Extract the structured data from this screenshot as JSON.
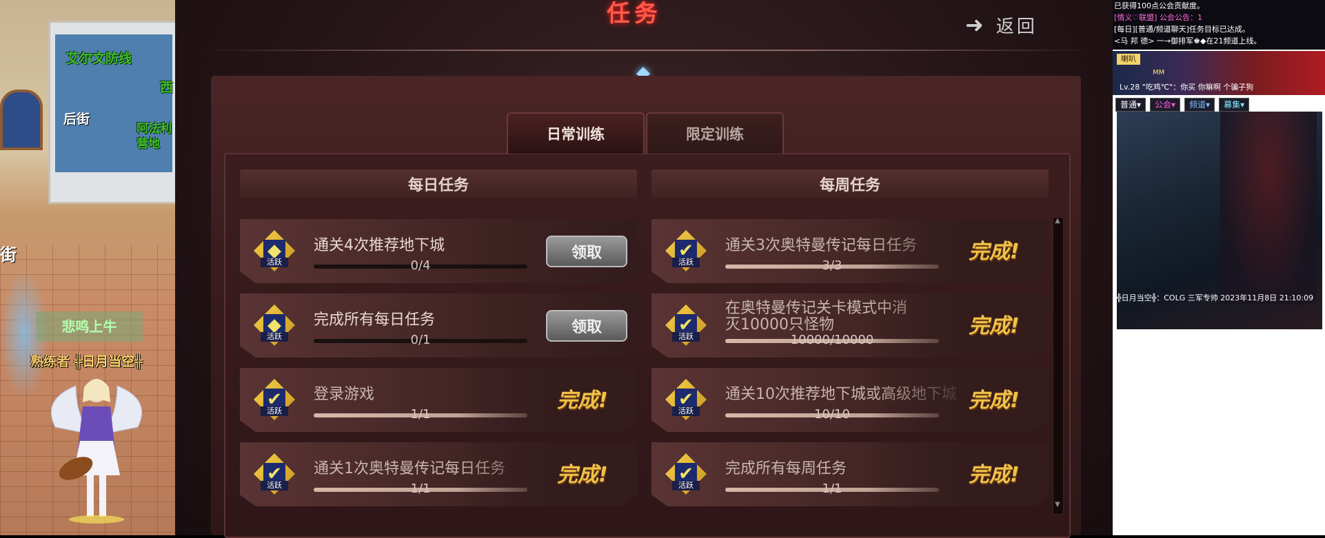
{
  "scene": {
    "map_labels": [
      "艾尔文防线",
      "后街",
      "阿法利营地",
      "西",
      "街"
    ],
    "sign_text": "悲鸣上牛",
    "character": {
      "prefix": "熟练者",
      "name": "╬日月当空╬"
    }
  },
  "header": {
    "title": "任务",
    "back_label": "返回",
    "back_icon": "arrow-left-icon"
  },
  "tabs": [
    {
      "label": "日常训练",
      "active": true
    },
    {
      "label": "限定训练",
      "active": false
    }
  ],
  "daily": {
    "header": "每日任务",
    "items": [
      {
        "name": "通关4次推荐地下城",
        "progress": "0/4",
        "fraction": 0.0,
        "status": "claim",
        "button": "领取",
        "icon": "dungeon-ticket-icon"
      },
      {
        "name": "完成所有每日任务",
        "progress": "0/1",
        "fraction": 0.0,
        "status": "claim",
        "button": "领取",
        "icon": "gem-box-icon"
      },
      {
        "name": "登录游戏",
        "progress": "1/1",
        "fraction": 1.0,
        "status": "done",
        "done_label": "完成!",
        "icon": "check-icon"
      },
      {
        "name": "通关1次奥特曼传记每日任务",
        "progress": "1/1",
        "fraction": 1.0,
        "status": "done",
        "done_label": "完成!",
        "icon": "check-icon"
      }
    ]
  },
  "weekly": {
    "header": "每周任务",
    "items": [
      {
        "name": "通关3次奥特曼传记每日任务",
        "progress": "3/3",
        "fraction": 1.0,
        "status": "done",
        "done_label": "完成!",
        "icon": "check-icon"
      },
      {
        "name": "在奥特曼传记关卡模式中消灭10000只怪物",
        "progress": "10000/10000",
        "fraction": 1.0,
        "status": "done",
        "done_label": "完成!",
        "icon": "check-icon"
      },
      {
        "name": "通关10次推荐地下城或高级地下城",
        "progress": "10/10",
        "fraction": 1.0,
        "status": "done",
        "done_label": "完成!",
        "icon": "check-icon"
      },
      {
        "name": "完成所有每周任务",
        "progress": "1/1",
        "fraction": 1.0,
        "status": "done",
        "done_label": "完成!",
        "icon": "check-icon"
      }
    ]
  },
  "icon_tag": "活跃",
  "chat": {
    "log": [
      "已获得100点公会贡献度。",
      "[情义♡联盟] 公会公告：1",
      "[每日][普通/频道聊天]任务目标已达成。",
      "<马 邦 德> 一→御排军♚◆在21频道上线。"
    ],
    "horn_label": "喇叭",
    "horn_line1": "MM",
    "horn_line2": "Lv.28 \"吃鸡℃\"：你买 你嘛啊 个骗子狗",
    "tabs": [
      "普通▾",
      "公会▾",
      "频道▾",
      "募集▾"
    ],
    "footer": "╬日月当空╬：COLG 三军专帅 2023年11月8日 21:10:09"
  },
  "colors": {
    "accent_red": "#ff5a4a",
    "complete_gold": "#f1c248"
  }
}
